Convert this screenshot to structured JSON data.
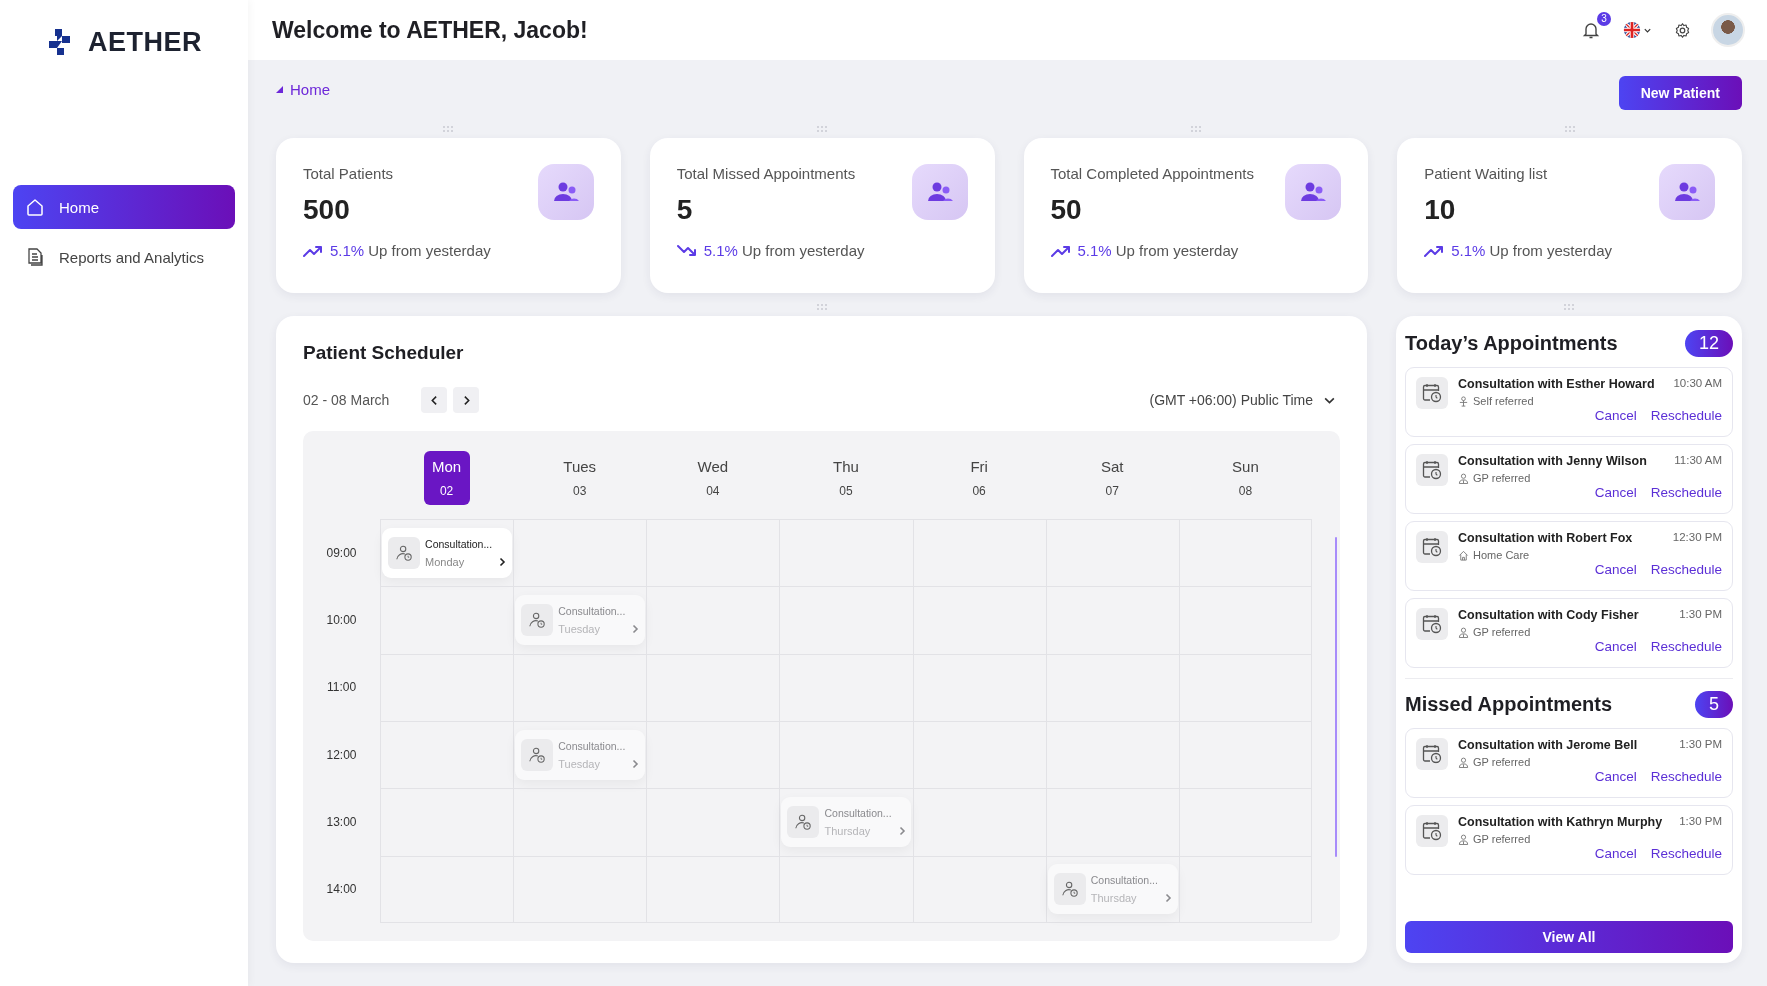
{
  "app": {
    "logo": "AETHER"
  },
  "sidebar": {
    "items": [
      {
        "label": "Home",
        "selected": true
      },
      {
        "label": "Reports and Analytics",
        "selected": false
      }
    ]
  },
  "header": {
    "title": "Welcome to AETHER, Jacob!",
    "notifications": "3"
  },
  "breadcrumb": [
    "Home"
  ],
  "new_patient_button": "New Patient",
  "stats": [
    {
      "title": "Total Patients",
      "value": "500",
      "kind": "rising",
      "change": "5.1%",
      "note": "Up from yesterday"
    },
    {
      "title": "Total Missed Appointments",
      "value": "5",
      "kind": "falling",
      "change": "5.1%",
      "note": "Up from yesterday"
    },
    {
      "title": "Total Completed Appointments",
      "value": "50",
      "kind": "rising",
      "change": "5.1%",
      "note": "Up from yesterday"
    },
    {
      "title": "Patient Waiting list",
      "value": "10",
      "kind": "rising",
      "change": "5.1%",
      "note": "Up from yesterday"
    }
  ],
  "scheduler": {
    "title": "Patient Scheduler",
    "range": "02 - 08 March",
    "timezone": "(GMT +06:00) Public Time",
    "days": [
      {
        "name": "Mon",
        "date": "02",
        "selected": true
      },
      {
        "name": "Tues",
        "date": "03",
        "selected": false
      },
      {
        "name": "Wed",
        "date": "04",
        "selected": false
      },
      {
        "name": "Thu",
        "date": "05",
        "selected": false
      },
      {
        "name": "Fri",
        "date": "06",
        "selected": false
      },
      {
        "name": "Sat",
        "date": "07",
        "selected": false
      },
      {
        "name": "Sun",
        "date": "08",
        "selected": false
      }
    ],
    "rows": [
      {
        "time": "09:00",
        "cells": [
          {
            "title": "Consultation...",
            "day_label": "Monday",
            "highlighted": true
          },
          null,
          null,
          null,
          null,
          null,
          null
        ]
      },
      {
        "time": "10:00",
        "cells": [
          null,
          {
            "title": "Consultation...",
            "day_label": "Tuesday",
            "highlighted": false
          },
          null,
          null,
          null,
          null,
          null
        ]
      },
      {
        "time": "11:00",
        "cells": [
          null,
          null,
          null,
          null,
          null,
          null,
          null
        ]
      },
      {
        "time": "12:00",
        "cells": [
          null,
          {
            "title": "Consultation...",
            "day_label": "Tuesday",
            "highlighted": false
          },
          null,
          null,
          null,
          null,
          null
        ]
      },
      {
        "time": "13:00",
        "cells": [
          null,
          null,
          null,
          {
            "title": "Consultation...",
            "day_label": "Thursday",
            "highlighted": false
          },
          null,
          null,
          null
        ]
      },
      {
        "time": "14:00",
        "cells": [
          null,
          null,
          null,
          null,
          null,
          {
            "title": "Consultation...",
            "day_label": "Thursday",
            "highlighted": false
          },
          null
        ]
      }
    ]
  },
  "appointment_sections": [
    {
      "title": "Today’s Appointments",
      "count": "12",
      "items": [
        {
          "title": "Consultation with Esther Howard",
          "time": "10:30 AM",
          "referral": "Self referred",
          "kind": "self",
          "cancel": "Cancel",
          "reschedule": "Reschedule"
        },
        {
          "title": "Consultation with Jenny Wilson",
          "time": "11:30 AM",
          "referral": "GP referred",
          "kind": "gp",
          "cancel": "Cancel",
          "reschedule": "Reschedule"
        },
        {
          "title": "Consultation with Robert Fox",
          "time": "12:30 PM",
          "referral": "Home Care",
          "kind": "home",
          "cancel": "Cancel",
          "reschedule": "Reschedule"
        },
        {
          "title": "Consultation with Cody Fisher",
          "time": "1:30 PM",
          "referral": "GP referred",
          "kind": "gp",
          "cancel": "Cancel",
          "reschedule": "Reschedule"
        }
      ]
    },
    {
      "title": "Missed Appointments",
      "count": "5",
      "items": [
        {
          "title": "Consultation with Jerome Bell",
          "time": "1:30 PM",
          "referral": "GP referred",
          "kind": "gp",
          "cancel": "Cancel",
          "reschedule": "Reschedule"
        },
        {
          "title": "Consultation with Kathryn Murphy",
          "time": "1:30 PM",
          "referral": "GP referred",
          "kind": "gp",
          "cancel": "Cancel",
          "reschedule": "Reschedule"
        }
      ]
    }
  ],
  "view_all_button": "View All"
}
